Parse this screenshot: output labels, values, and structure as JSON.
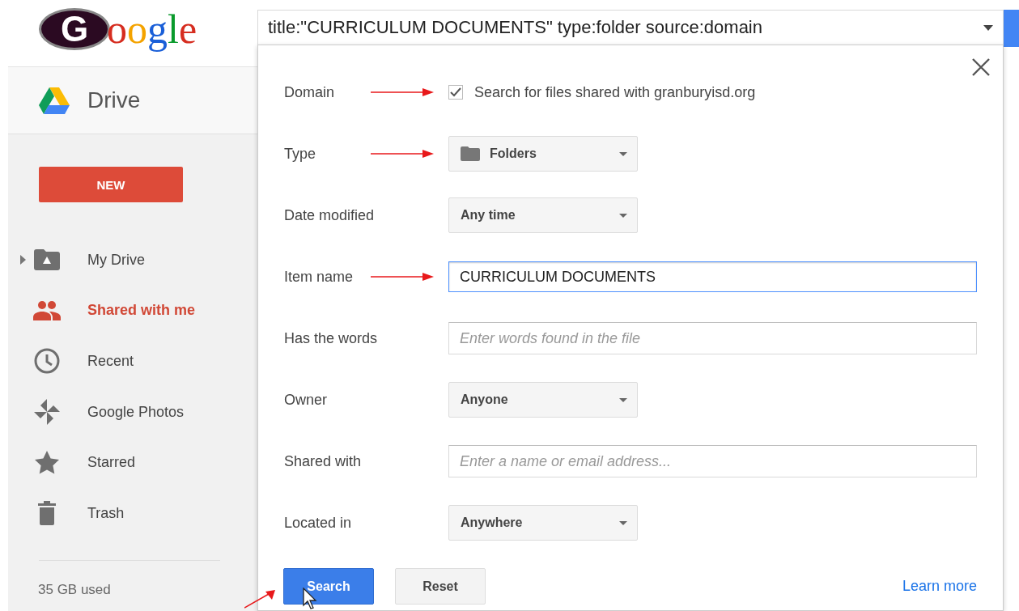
{
  "logo": {
    "emblem": "G",
    "text": "oogle"
  },
  "search_bar": {
    "value": "title:\"CURRICULUM DOCUMENTS\" type:folder source:domain"
  },
  "app": {
    "title": "Drive"
  },
  "new_button": {
    "label": "NEW"
  },
  "sidebar": {
    "items": [
      {
        "kind": "drive",
        "label": "My Drive",
        "selected": false,
        "expandable": true
      },
      {
        "kind": "people",
        "label": "Shared with me",
        "selected": true,
        "expandable": false
      },
      {
        "kind": "clock",
        "label": "Recent",
        "selected": false,
        "expandable": false
      },
      {
        "kind": "photos",
        "label": "Google Photos",
        "selected": false,
        "expandable": false
      },
      {
        "kind": "star",
        "label": "Starred",
        "selected": false,
        "expandable": false
      },
      {
        "kind": "trash",
        "label": "Trash",
        "selected": false,
        "expandable": false
      }
    ]
  },
  "storage": {
    "text": "35 GB used"
  },
  "dialog": {
    "rows": [
      {
        "kind": "checkbox",
        "label": "Domain",
        "checked": true,
        "text": "Search for files shared with granburyisd.org",
        "arrow": true
      },
      {
        "kind": "select",
        "label": "Type",
        "value": "Folders",
        "folder_icon": true,
        "arrow": true
      },
      {
        "kind": "select",
        "label": "Date modified",
        "value": "Any time",
        "folder_icon": false,
        "arrow": false
      },
      {
        "kind": "input",
        "label": "Item name",
        "value": "CURRICULUM DOCUMENTS",
        "focused": true,
        "arrow": true
      },
      {
        "kind": "input",
        "label": "Has the words",
        "placeholder": "Enter words found in the file",
        "focused": false,
        "arrow": false
      },
      {
        "kind": "select",
        "label": "Owner",
        "value": "Anyone",
        "folder_icon": false,
        "arrow": false
      },
      {
        "kind": "input",
        "label": "Shared with",
        "placeholder": "Enter a name or email address...",
        "focused": false,
        "arrow": false
      },
      {
        "kind": "select",
        "label": "Located in",
        "value": "Anywhere",
        "folder_icon": false,
        "arrow": false
      }
    ],
    "buttons": [
      {
        "kind": "primary",
        "label": "Search",
        "arrow": true
      },
      {
        "kind": "secondary",
        "label": "Reset",
        "arrow": false
      }
    ],
    "link": "Learn more"
  }
}
